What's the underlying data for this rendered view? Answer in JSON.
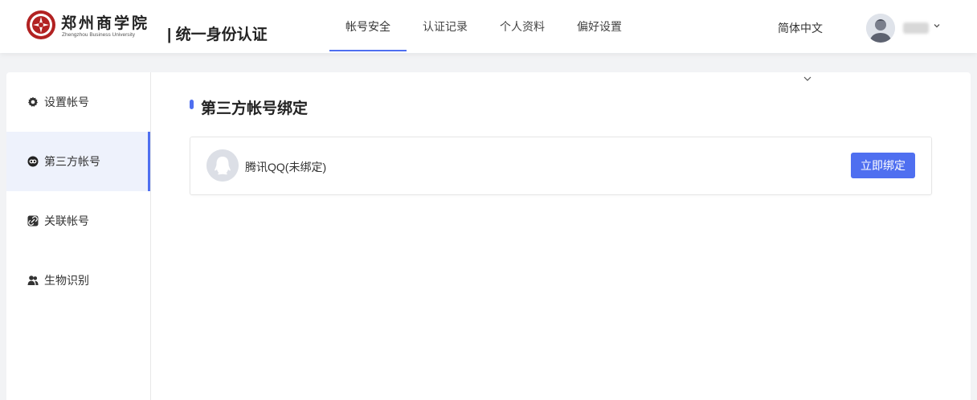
{
  "header": {
    "logo": {
      "cn": "郑州商学院",
      "en": "Zhengzhou Business University"
    },
    "app_title": "| 统一身份认证",
    "nav": [
      {
        "label": "帐号安全",
        "active": true
      },
      {
        "label": "认证记录",
        "active": false
      },
      {
        "label": "个人资料",
        "active": false
      },
      {
        "label": "偏好设置",
        "active": false
      }
    ],
    "language": "简体中文",
    "user": {
      "avatar_icon": "user-avatar-icon",
      "menu_icon": "chevron-down-icon"
    }
  },
  "sidebar": {
    "items": [
      {
        "label": "设置帐号",
        "icon": "gear-icon",
        "active": false
      },
      {
        "label": "第三方帐号",
        "icon": "link-circle-icon",
        "active": true
      },
      {
        "label": "关联帐号",
        "icon": "chain-link-icon",
        "active": false
      },
      {
        "label": "生物识别",
        "icon": "users-icon",
        "active": false
      }
    ]
  },
  "main": {
    "section_title": "第三方帐号绑定",
    "bindings": [
      {
        "name": "腾讯QQ(未绑定)",
        "icon": "qq-penguin-icon",
        "action": "立即绑定"
      }
    ]
  },
  "colors": {
    "accent": "#4f6ff0",
    "active_bg": "#eef2fc",
    "page_bg": "#f2f3f5"
  }
}
